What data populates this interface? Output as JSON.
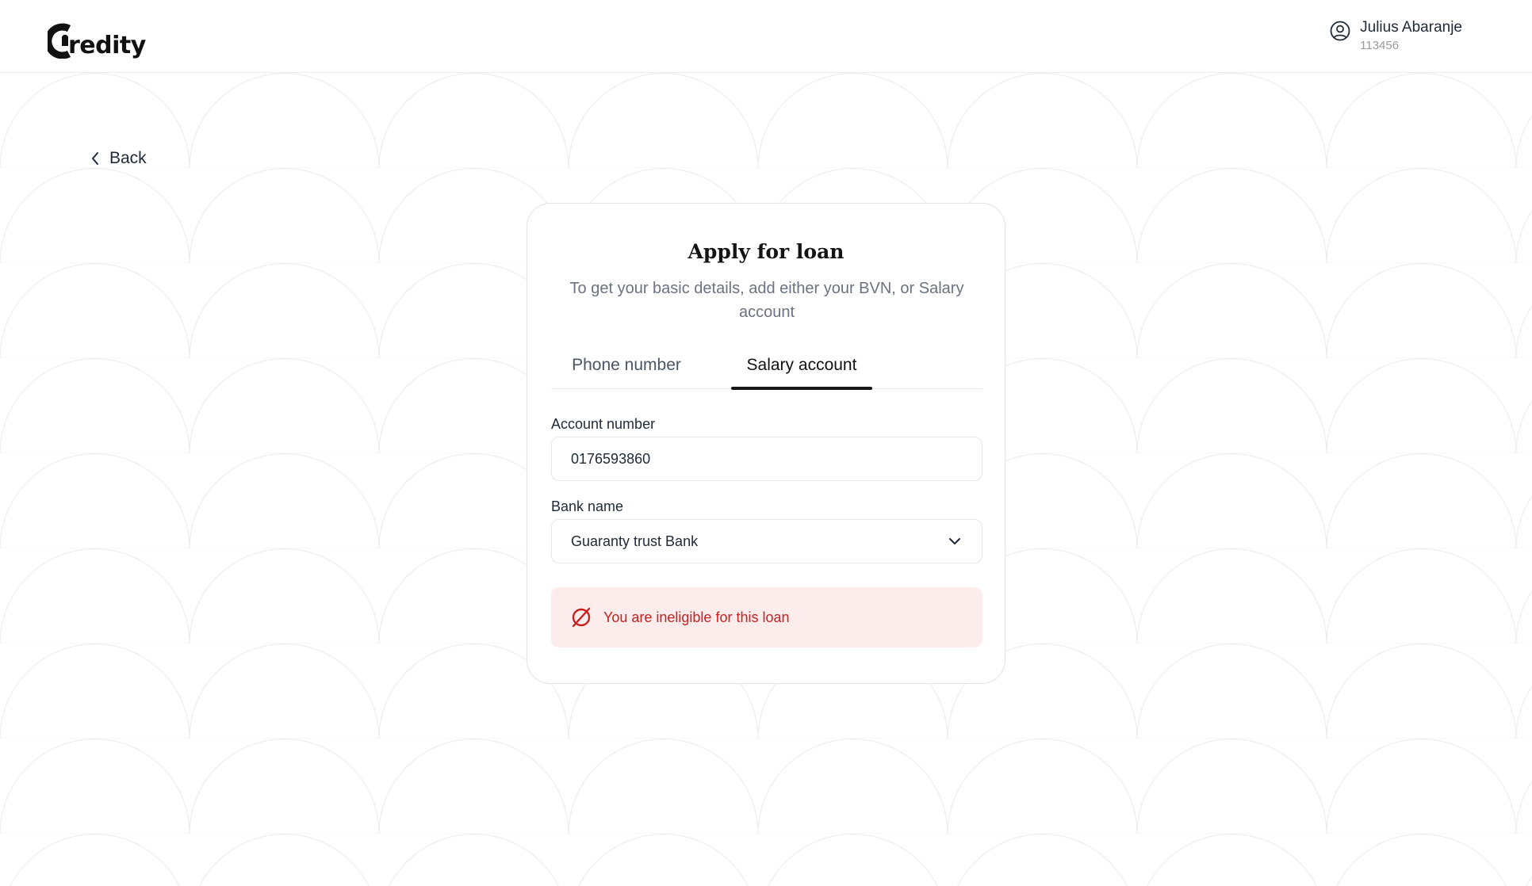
{
  "brand": {
    "logo_text": "redity"
  },
  "user": {
    "name": "Julius Abaranje",
    "id": "113456",
    "icon": "user-circle-icon"
  },
  "nav": {
    "back_label": "Back",
    "back_icon": "chevron-left-icon"
  },
  "card": {
    "title": "Apply for loan",
    "subtitle": "To get your basic details, add either your BVN,  or Salary account",
    "tabs": [
      {
        "label": "Phone number",
        "active": false
      },
      {
        "label": "Salary account",
        "active": true
      }
    ],
    "account_field": {
      "label": "Account number",
      "value": "0176593860"
    },
    "bank_field": {
      "label": "Bank name",
      "value": "Guaranty trust Bank",
      "icon": "chevron-down-icon"
    },
    "alert": {
      "text": "You are ineligible for this loan",
      "icon": "prohibited-icon",
      "color": "#c8201f",
      "background": "#fdecec"
    }
  },
  "colors": {
    "accent": "#161616",
    "background": "#ffffff",
    "pattern_stroke": "#ececec"
  }
}
